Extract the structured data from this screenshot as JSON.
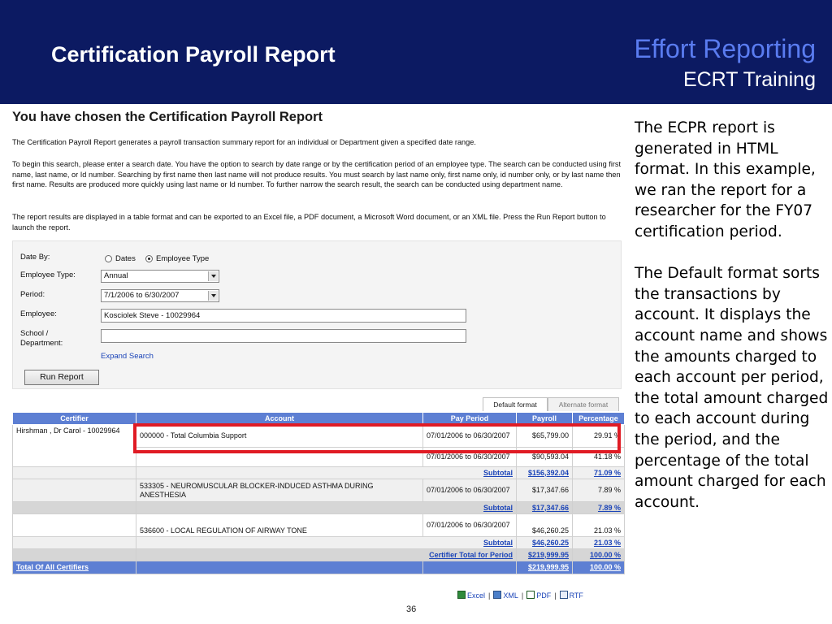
{
  "slide": {
    "title": "Certification Payroll Report",
    "brand": "Effort Reporting",
    "subtitle": "ECRT Training",
    "page_number": "36"
  },
  "screen": {
    "heading": "You have chosen the Certification Payroll Report",
    "para1": "The Certification Payroll Report generates a payroll transaction summary report for an individual or Department given a specified date range.",
    "para2": "To begin this search, please enter a search date. You have the option to search by date range or by the certification period of an employee type. The search can be conducted using first name, last name, or Id number. Searching by first name then last name will not produce results. You must search by last name only, first name only, id number only, or by last name then first name. Results are produced more quickly using last name or Id number. To further narrow the search result, the search can be conducted using department name.",
    "para3": "The report results are displayed in a table format and can be exported to an Excel file, a PDF document, a Microsoft Word document, or an XML file. Press the Run Report button to launch the report.",
    "form": {
      "date_by_label": "Date By:",
      "radio_dates": "Dates",
      "radio_employee_type": "Employee Type",
      "employee_type_label": "Employee Type:",
      "employee_type_value": "Annual",
      "period_label": "Period:",
      "period_value": "7/1/2006 to 6/30/2007",
      "employee_label": "Employee:",
      "employee_value": "Kosciolek Steve  - 10029964",
      "school_label_1": "School /",
      "school_label_2": "Department:",
      "school_value": "",
      "expand_search": "Expand Search",
      "run_report": "Run Report"
    },
    "tabs": {
      "default": "Default format",
      "alternate": "Alternate format"
    },
    "table": {
      "headers": [
        "Certifier",
        "Account",
        "Pay Period",
        "Payroll",
        "Percentage"
      ],
      "certifier": "Hirshman , Dr Carol - 10029964",
      "rows": [
        {
          "account": "000000 - Total Columbia Support",
          "period": "07/01/2006 to 06/30/2007",
          "payroll": "$65,799.00",
          "percentage": "29.91 %"
        },
        {
          "account": "",
          "period": "07/01/2006 to 06/30/2007",
          "payroll": "$90,593.04",
          "percentage": "41.18 %"
        },
        {
          "account": "533305 - NEUROMUSCULAR BLOCKER-INDUCED ASTHMA DURING ANESTHESIA",
          "period": "07/01/2006 to 06/30/2007",
          "payroll": "$17,347.66",
          "percentage": "7.89 %"
        },
        {
          "account": "536600 - LOCAL REGULATION OF AIRWAY TONE",
          "period": "07/01/2006 to 06/30/2007",
          "payroll": "$46,260.25",
          "percentage": "21.03 %"
        }
      ],
      "subtotals": [
        {
          "label": "Subtotal",
          "pct": "71.09 %",
          "payroll": "$156,392.04",
          "percentage": "71.09 %"
        },
        {
          "label": "Subtotal",
          "pct": "7.89 %",
          "payroll": "$17,347.66",
          "percentage": "7.89 %"
        },
        {
          "label": "Subtotal",
          "pct": "21.03 %",
          "payroll": "$46,260.25",
          "percentage": "21.03 %"
        }
      ],
      "certifier_total": {
        "label": "Certifier Total for Period",
        "pct": "100.00 %",
        "payroll": "$219,999.95",
        "percentage": "100.00 %"
      },
      "grand_total": {
        "label": "Total Of All Certifiers",
        "payroll": "$219,999.95",
        "percentage": "100.00 %"
      }
    },
    "export": {
      "excel": "Excel",
      "xml": "XML",
      "pdf": "PDF",
      "rtf": "RTF"
    }
  },
  "notes": {
    "para1": "The ECPR report is generated in HTML format. In this example, we ran the report for a researcher for the FY07 certification period.",
    "para2": "The Default format sorts the transactions by account. It displays the account name and shows the amounts charged to each account per period, the total amount charged to each account during the period, and the percentage of the total amount charged for each account."
  },
  "colors": {
    "header_bg": "#0c1a62",
    "brand": "#5a7cf0",
    "table_header": "#5d7fd3",
    "highlight": "#e01b24",
    "link": "#1b44b8"
  }
}
